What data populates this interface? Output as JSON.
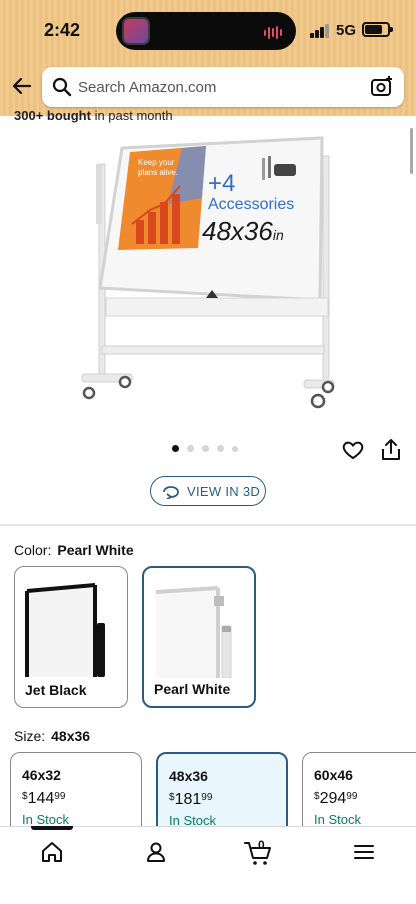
{
  "status_bar": {
    "time": "2:42",
    "network": "5G",
    "battery_level": 0.65
  },
  "search": {
    "placeholder": "Search Amazon.com"
  },
  "sold_strip": {
    "count": "300+ bought",
    "suffix": "in past month"
  },
  "product_image": {
    "banner_text": "Keep your plans alive.",
    "headline_plus": "+4",
    "headline_accessories": "Accessories",
    "headline_size": "48x36",
    "headline_unit": "in",
    "carousel_count": 5,
    "carousel_active_index": 0
  },
  "view3d": {
    "label": "VIEW IN 3D"
  },
  "color": {
    "label": "Color:",
    "selected": "Pearl White",
    "options": [
      {
        "name": "Jet Black",
        "selected": false
      },
      {
        "name": "Pearl White",
        "selected": true
      }
    ]
  },
  "size": {
    "label": "Size:",
    "selected": "48x36",
    "options": [
      {
        "name": "46x32",
        "symbol": "$",
        "whole": "144",
        "cents": "99",
        "stock": "In Stock",
        "selected": false
      },
      {
        "name": "48x36",
        "symbol": "$",
        "whole": "181",
        "cents": "99",
        "stock": "In Stock",
        "selected": true
      },
      {
        "name": "60x46",
        "symbol": "$",
        "whole": "294",
        "cents": "99",
        "stock": "In Stock",
        "selected": false
      }
    ]
  },
  "tabbar": {
    "items": [
      {
        "icon": "home-icon",
        "active": true
      },
      {
        "icon": "account-icon",
        "active": false
      },
      {
        "icon": "cart-icon",
        "active": false,
        "count": "0"
      },
      {
        "icon": "menu-icon",
        "active": false
      }
    ]
  },
  "colors": {
    "accent": "#2b5b84",
    "in_stock": "#067d62",
    "header": "#f1c98b",
    "selected_bg": "#eaf6fe"
  }
}
